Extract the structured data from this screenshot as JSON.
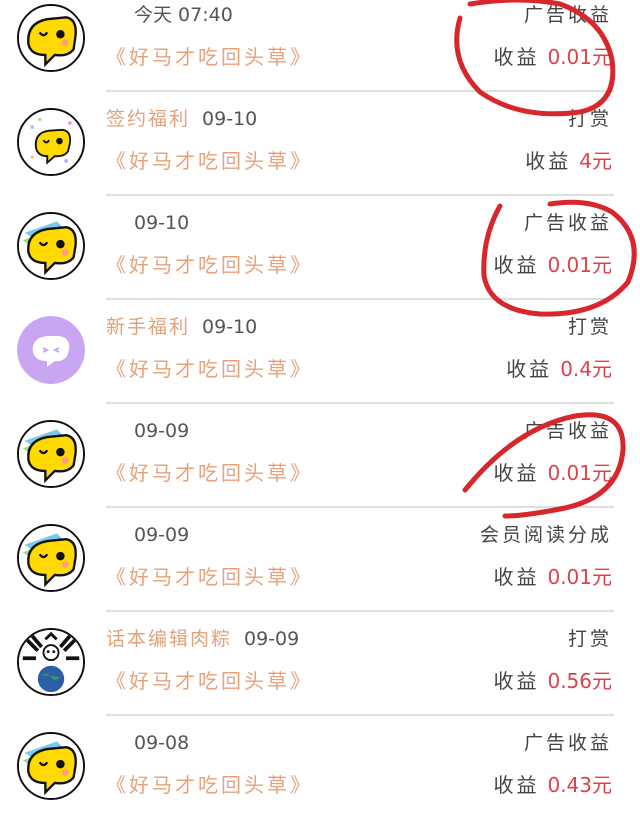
{
  "transactions": [
    {
      "tag": "",
      "date": "今天 07:40",
      "book": "《好马才吃回头草》",
      "type": "广告收益",
      "earn_label": "收益",
      "amount": "0.01元",
      "avatar": "yellow-chat-icon"
    },
    {
      "tag": "签约福利",
      "date": "09-10",
      "book": "《好马才吃回头草》",
      "type": "打赏",
      "earn_label": "收益",
      "amount": "4元",
      "avatar": "yellow-chat-icon-confetti"
    },
    {
      "tag": "",
      "date": "09-10",
      "book": "《好马才吃回头草》",
      "type": "广告收益",
      "earn_label": "收益",
      "amount": "0.01元",
      "avatar": "yellow-chat-icon"
    },
    {
      "tag": "新手福利",
      "date": "09-10",
      "book": "《好马才吃回头草》",
      "type": "打赏",
      "earn_label": "收益",
      "amount": "0.4元",
      "avatar": "purple-chat-icon"
    },
    {
      "tag": "",
      "date": "09-09",
      "book": "《好马才吃回头草》",
      "type": "广告收益",
      "earn_label": "收益",
      "amount": "0.01元",
      "avatar": "yellow-chat-icon"
    },
    {
      "tag": "",
      "date": "09-09",
      "book": "《好马才吃回头草》",
      "type": "会员阅读分成",
      "earn_label": "收益",
      "amount": "0.01元",
      "avatar": "yellow-chat-icon"
    },
    {
      "tag": "话本编辑肉粽",
      "date": "09-09",
      "book": "《好马才吃回头草》",
      "type": "打赏",
      "earn_label": "收益",
      "amount": "0.56元",
      "avatar": "earth-comic-avatar"
    },
    {
      "tag": "",
      "date": "09-08",
      "book": "《好马才吃回头草》",
      "type": "广告收益",
      "earn_label": "收益",
      "amount": "0.43元",
      "avatar": "yellow-chat-icon"
    }
  ],
  "colors": {
    "book_title": "#e7a27a",
    "tag": "#e0a27a",
    "amount": "#d9434b",
    "annotation": "#d8262d"
  }
}
